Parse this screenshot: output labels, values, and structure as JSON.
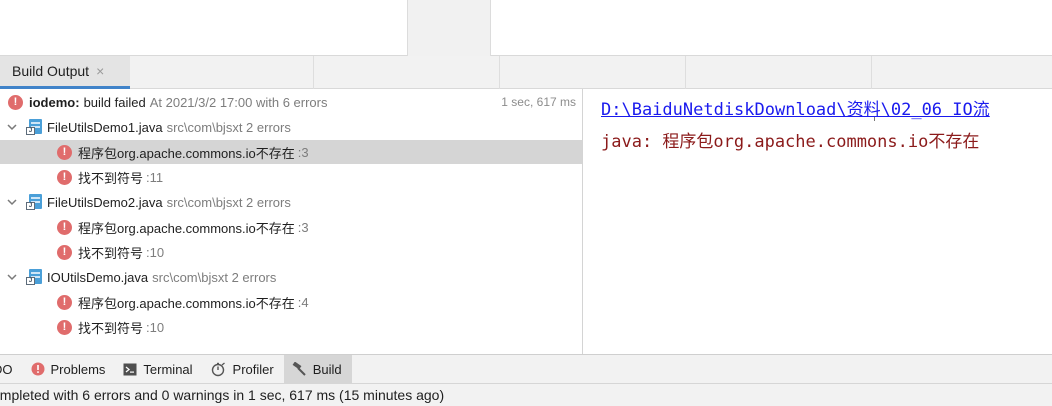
{
  "header": {
    "tab_label": "Build Output",
    "close_glyph": "×"
  },
  "tree": {
    "root": {
      "project": "iodemo:",
      "status": "build failed",
      "detail": "At 2021/3/2 17:00 with 6 errors",
      "duration": "1 sec, 617 ms"
    },
    "files": [
      {
        "name": "FileUtilsDemo1.java",
        "path": "src\\com\\bjsxt 2 errors",
        "errors": [
          {
            "message": "程序包org.apache.commons.io不存在",
            "line": ":3"
          },
          {
            "message": "找不到符号",
            "line": ":11"
          }
        ]
      },
      {
        "name": "FileUtilsDemo2.java",
        "path": "src\\com\\bjsxt 2 errors",
        "errors": [
          {
            "message": "程序包org.apache.commons.io不存在",
            "line": ":3"
          },
          {
            "message": "找不到符号",
            "line": ":10"
          }
        ]
      },
      {
        "name": "IOUtilsDemo.java",
        "path": "src\\com\\bjsxt 2 errors",
        "errors": [
          {
            "message": "程序包org.apache.commons.io不存在",
            "line": ":4"
          },
          {
            "message": "找不到符号",
            "line": ":10"
          }
        ]
      }
    ]
  },
  "console": {
    "path_link": "D:\\BaiduNetdiskDownload\\资料\\02_06 IO流",
    "message": "java: 程序包org.apache.commons.io不存在"
  },
  "toolbar": {
    "todo": "DO",
    "problems": "Problems",
    "terminal": "Terminal",
    "profiler": "Profiler",
    "build": "Build"
  },
  "status": {
    "text": "ompleted with 6 errors and 0 warnings in 1 sec, 617 ms (15 minutes ago)"
  },
  "colors": {
    "error": "#e06c6c",
    "link": "#1a1aee",
    "console_error": "#8b1a1a",
    "accent": "#4083c9"
  }
}
